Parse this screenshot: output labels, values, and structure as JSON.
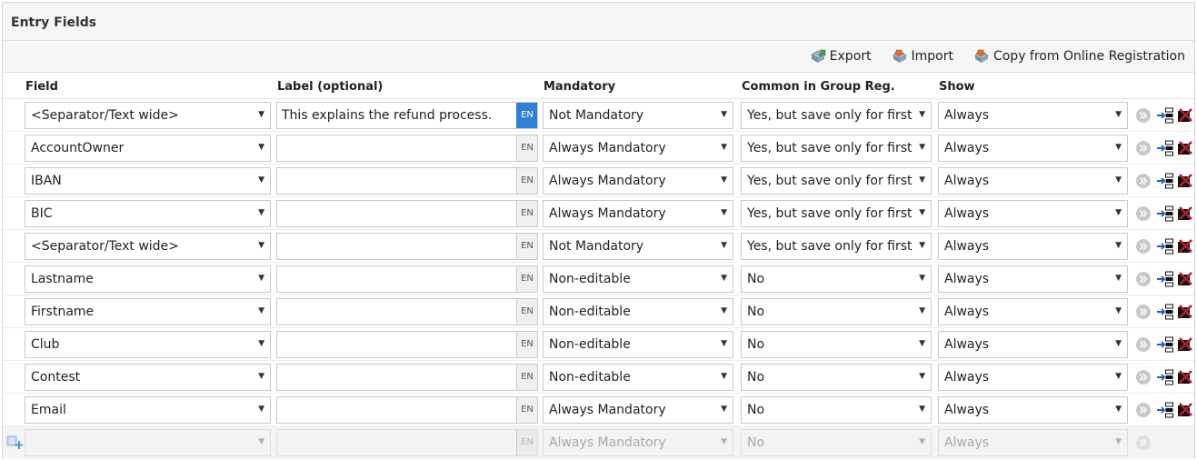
{
  "panel": {
    "title": "Entry Fields"
  },
  "toolbar": {
    "export_label": "Export",
    "import_label": "Import",
    "copy_label": "Copy from Online Registration"
  },
  "columns": {
    "field": "Field",
    "label": "Label (optional)",
    "mandatory": "Mandatory",
    "common": "Common in Group Reg.",
    "show": "Show"
  },
  "language_code": "EN",
  "rows": [
    {
      "field": "<Separator/Text wide>",
      "label": "This explains the refund process.",
      "label_lang_active": true,
      "mandatory": "Not Mandatory",
      "common": "Yes, but save only for first r",
      "show": "Always"
    },
    {
      "field": "AccountOwner",
      "label": "",
      "label_lang_active": false,
      "mandatory": "Always Mandatory",
      "common": "Yes, but save only for first r",
      "show": "Always"
    },
    {
      "field": "IBAN",
      "label": "",
      "label_lang_active": false,
      "mandatory": "Always Mandatory",
      "common": "Yes, but save only for first r",
      "show": "Always"
    },
    {
      "field": "BIC",
      "label": "",
      "label_lang_active": false,
      "mandatory": "Always Mandatory",
      "common": "Yes, but save only for first r",
      "show": "Always"
    },
    {
      "field": "<Separator/Text wide>",
      "label": "",
      "label_lang_active": false,
      "mandatory": "Not Mandatory",
      "common": "Yes, but save only for first r",
      "show": "Always"
    },
    {
      "field": "Lastname",
      "label": "",
      "label_lang_active": false,
      "mandatory": "Non-editable",
      "common": "No",
      "show": "Always"
    },
    {
      "field": "Firstname",
      "label": "",
      "label_lang_active": false,
      "mandatory": "Non-editable",
      "common": "No",
      "show": "Always"
    },
    {
      "field": "Club",
      "label": "",
      "label_lang_active": false,
      "mandatory": "Non-editable",
      "common": "No",
      "show": "Always"
    },
    {
      "field": "Contest",
      "label": "",
      "label_lang_active": false,
      "mandatory": "Non-editable",
      "common": "No",
      "show": "Always"
    },
    {
      "field": "Email",
      "label": "",
      "label_lang_active": false,
      "mandatory": "Always Mandatory",
      "common": "No",
      "show": "Always"
    }
  ],
  "new_row": {
    "field": "",
    "label": "",
    "mandatory": "Always Mandatory",
    "common": "No",
    "show": "Always"
  },
  "colors": {
    "en_active": "#2f7fd6",
    "delete_red": "#b0202a",
    "insert_blue": "#1e5fb4"
  }
}
